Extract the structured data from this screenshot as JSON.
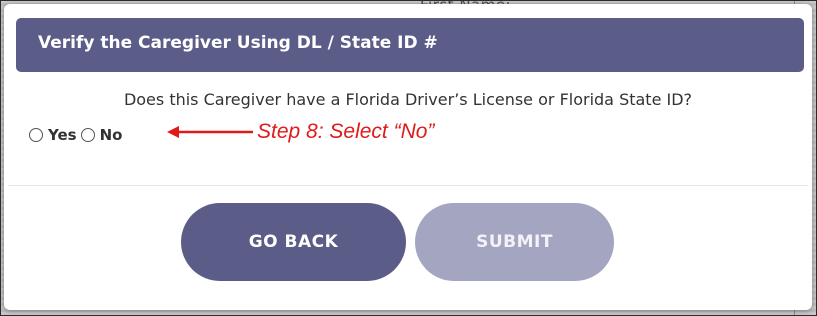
{
  "background": {
    "ghost_label": "First Name:"
  },
  "modal": {
    "title": "Verify the Caregiver Using DL / State ID #",
    "question": "Does this Caregiver have a Florida Driver’s License or Florida State ID?",
    "options": [
      {
        "label": "Yes",
        "selected": false
      },
      {
        "label": "No",
        "selected": false
      }
    ],
    "buttons": {
      "back": "GO BACK",
      "submit": "SUBMIT"
    }
  },
  "annotation": {
    "text": "Step 8: Select “No”",
    "color": "#e01919"
  },
  "colors": {
    "header_bg": "#5b5c88",
    "primary_button": "#5b5c88",
    "disabled_button": "#a4a5c0"
  },
  "icons": {
    "radio_unselected": "radio-circle-icon",
    "annotation_arrow": "arrow-left-icon"
  }
}
